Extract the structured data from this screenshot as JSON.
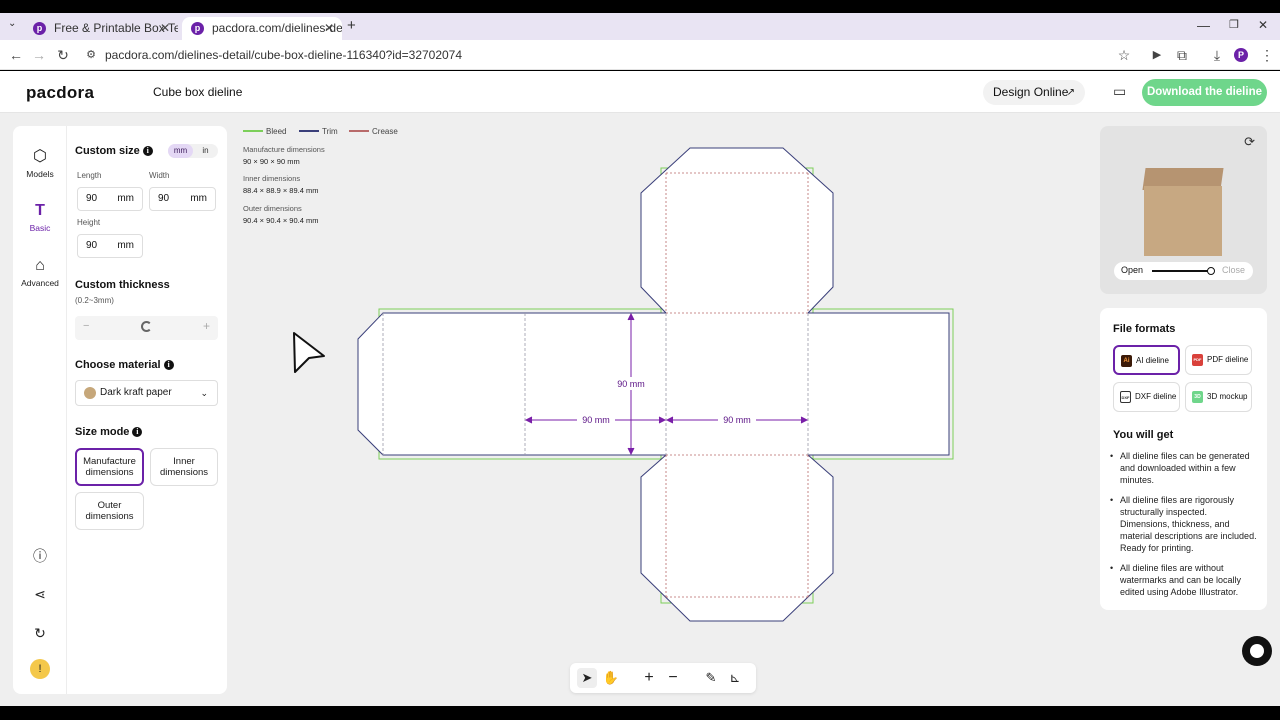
{
  "browser": {
    "tabs": [
      {
        "label": "Free & Printable Box Templat",
        "favicon": "pacdora-icon"
      },
      {
        "label": "pacdora.com/dielines-detail/",
        "favicon": "pacdora-icon"
      }
    ],
    "url": "pacdora.com/dielines-detail/cube-box-dieline-116340?id=32702074",
    "profile_initial": "P"
  },
  "header": {
    "logo": "pacdora",
    "title": "Cube box dieline",
    "design_online": "Design Online",
    "download": "Download the dieline"
  },
  "rail": {
    "items": [
      {
        "label": "Models",
        "icon": "cube-icon"
      },
      {
        "label": "Basic",
        "icon": "ruler-icon"
      },
      {
        "label": "Advanced",
        "icon": "advanced-icon"
      }
    ]
  },
  "settings": {
    "custom_size": "Custom size",
    "unit_mm": "mm",
    "unit_in": "in",
    "length_label": "Length",
    "length_value": "90",
    "width_label": "Width",
    "width_value": "90",
    "height_label": "Height",
    "height_value": "90",
    "unit": "mm",
    "thickness_title": "Custom thickness",
    "thickness_range": "(0.2~3mm)",
    "thickness_minus": "−",
    "thickness_plus": "+",
    "material_title": "Choose material",
    "material_value": "Dark kraft paper",
    "material_color": "#c6a77a",
    "size_mode_title": "Size mode",
    "modes": [
      "Manufacture dimensions",
      "Inner dimensions",
      "Outer dimensions"
    ],
    "selected_mode": "Manufacture dimensions"
  },
  "canvas": {
    "legend": [
      {
        "label": "Bleed",
        "color": "#7ccf5a"
      },
      {
        "label": "Trim",
        "color": "#3a3f7a"
      },
      {
        "label": "Crease",
        "color": "#b86a6a"
      }
    ],
    "dims": [
      {
        "label": "Manufacture dimensions",
        "value": "90 × 90 × 90 mm"
      },
      {
        "label": "Inner dimensions",
        "value": "88.4 × 88.9 × 89.4 mm"
      },
      {
        "label": "Outer dimensions",
        "value": "90.4 × 90.4 × 90.4 mm"
      }
    ],
    "annotations": {
      "height": "90 mm",
      "width_a": "90 mm",
      "width_b": "90 mm"
    }
  },
  "preview": {
    "open": "Open",
    "close": "Close",
    "slider_position": 1.0
  },
  "file_formats": {
    "title": "File formats",
    "items": [
      {
        "label": "AI dieline",
        "icon": "ai-file-icon",
        "color": "#3b1a08",
        "badge": "Ai"
      },
      {
        "label": "PDF dieline",
        "icon": "pdf-file-icon",
        "color": "#d9413b",
        "badge": "PDF"
      },
      {
        "label": "DXF dieline",
        "icon": "dxf-file-icon",
        "color": "#333333",
        "badge": "DXF"
      },
      {
        "label": "3D mockup",
        "icon": "mockup-icon",
        "color": "#6fd68b",
        "badge": "3D"
      }
    ],
    "selected": "AI dieline",
    "you_will_get": "You will get",
    "bullets": [
      "All dieline files can be generated and downloaded within a few minutes.",
      "All dieline files are rigorously structurally inspected. Dimensions, thickness, and material descriptions are included. Ready for printing.",
      "All dieline files are without watermarks and can be locally edited using Adobe Illustrator."
    ]
  },
  "colors": {
    "brand": "#6b21a8",
    "accent_green": "#6fd68b",
    "trim": "#3a3f7a",
    "bleed": "#7ccf5a",
    "crease": "#b86a6a",
    "dim": "#7a1fa8"
  }
}
